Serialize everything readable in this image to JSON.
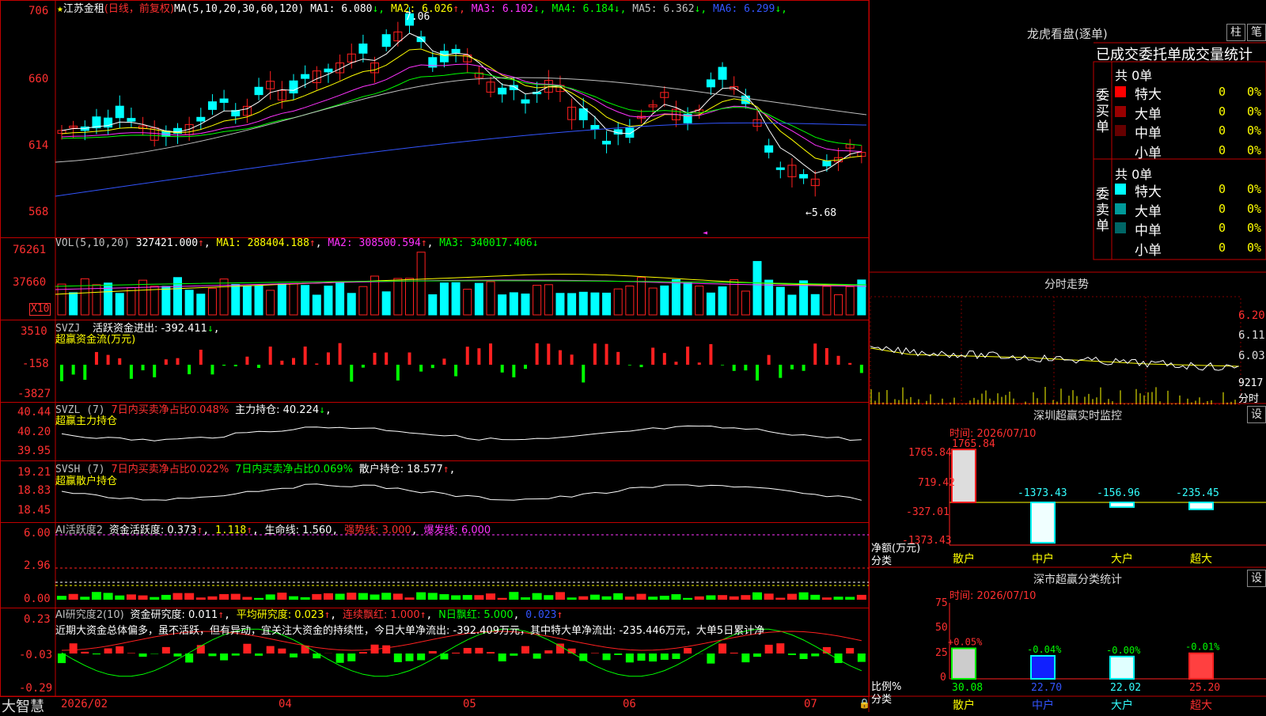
{
  "stock": {
    "name": "江苏金租",
    "mode": "(日线，前复权)",
    "ma_def": "MA(5,10,20,30,60,120)",
    "star": "★"
  },
  "ma_legend": [
    {
      "label": "MA1: 6.080",
      "arrow": "↓",
      "color": "#ffffff"
    },
    {
      "label": "MA2: 6.026",
      "arrow": "↑",
      "color": "#ffff00"
    },
    {
      "label": "MA3: 6.102",
      "arrow": "↓",
      "color": "#ff33ff"
    },
    {
      "label": "MA4: 6.184",
      "arrow": "↓",
      "color": "#00ff00"
    },
    {
      "label": "MA5: 6.362",
      "arrow": "↓",
      "color": "#c0c0c0"
    },
    {
      "label": "MA6: 6.299",
      "arrow": "↓",
      "color": "#3355ff"
    }
  ],
  "price_axis": [
    "706",
    "660",
    "614",
    "568"
  ],
  "price_high_label": "7.06",
  "price_low_label": "←5.68",
  "vol": {
    "header": "VOL(5,10,20)",
    "value": "327421.000",
    "ma1": "MA1: 288404.188",
    "ma2": "MA2: 308500.594",
    "ma3": "MA3: 340017.406",
    "axis": [
      "76261",
      "37660"
    ],
    "unit": "X10"
  },
  "svzj": {
    "header": "SVZJ",
    "title": "活跃资金进出: -392.411",
    "subtitle": "超赢资金流(万元)",
    "axis": [
      "3510",
      "-158",
      "-3827"
    ]
  },
  "svzl": {
    "header": "SVZL (7)",
    "t1": "7日内买卖净占比0.048%",
    "t2": "主力持仓: 40.224",
    "subtitle": "超赢主力持仓",
    "axis": [
      "40.44",
      "40.20",
      "39.95"
    ]
  },
  "svsh": {
    "header": "SVSH (7)",
    "t1": "7日内买卖净占比0.022%",
    "t2": "7日内买卖净占比0.069%",
    "t3": "散户持仓: 18.577",
    "subtitle": "超赢散户持仓",
    "axis": [
      "19.21",
      "18.83",
      "18.45"
    ]
  },
  "ai1": {
    "header": "AI活跃度2",
    "t1": "资金活跃度: 0.373",
    "t2": "1.118",
    "t3": "生命线: 1.560",
    "t4": "强势线: 3.000",
    "t5": "爆发线: 6.000",
    "axis": [
      "6.00",
      "2.96",
      "0.00"
    ]
  },
  "ai2": {
    "header": "AI研究度2(10)",
    "t1": "资金研究度: 0.011",
    "t2": "平均研究度: 0.023",
    "t3": "连续飘红: 1.000",
    "t4": "N日飘红: 5.000",
    "t5": "0.023",
    "comment": "近期大资金总体偏多，虽不活跃，但有异动，宜关注大资金的持续性，今日大单净流出: -392.409万元，其中特大单净流出: -235.446万元，大单5日累计净",
    "axis": [
      "0.23",
      "-0.03",
      "-0.29"
    ]
  },
  "xaxis": [
    "2026/02",
    "04",
    "05",
    "06",
    "07"
  ],
  "footer_logo": "大智慧",
  "right": {
    "lhb_title": "龙虎看盘(逐单)",
    "btn1": "柱",
    "btn2": "笔",
    "tabs": "已成交委托单成交量统计",
    "buy_label": "委买单",
    "sell_label": "委卖单",
    "buy_total": "共 0单",
    "sell_total": "共 0单",
    "buy_rows": [
      {
        "name": "特大",
        "count": "0",
        "pct": "0%",
        "color": "#ff0000"
      },
      {
        "name": "大单",
        "count": "0",
        "pct": "0%",
        "color": "#990000"
      },
      {
        "name": "中单",
        "count": "0",
        "pct": "0%",
        "color": "#660000"
      },
      {
        "name": "小单",
        "count": "0",
        "pct": "0%",
        "color": "#000000"
      }
    ],
    "sell_rows": [
      {
        "name": "特大",
        "count": "0",
        "pct": "0%",
        "color": "#00ffff"
      },
      {
        "name": "大单",
        "count": "0",
        "pct": "0%",
        "color": "#009999"
      },
      {
        "name": "中单",
        "count": "0",
        "pct": "0%",
        "color": "#006666"
      },
      {
        "name": "小单",
        "count": "0",
        "pct": "0%",
        "color": "#000000"
      }
    ],
    "intraday_title": "分时走势",
    "intraday_axis": [
      "6.20",
      "6.11",
      "6.03"
    ],
    "intraday_vol": "9217",
    "intraday_label": "分时",
    "monitor_title": "深圳超赢实时监控",
    "set": "设",
    "monitor_time": "时间: 2026/07/10",
    "monitor_axis": [
      "1765.84",
      "719.42",
      "-327.01",
      "-1373.43"
    ],
    "monitor_ylabel": "净额(万元)",
    "monitor_xlabel": "分类",
    "classify_title": "深市超赢分类统计",
    "classify_time": "时间: 2026/07/10",
    "classify_axis": [
      "75",
      "50",
      "25",
      "0"
    ],
    "classify_ylabel": "比例%",
    "classify_xlabel": "分类"
  },
  "chart_data": [
    {
      "type": "bar",
      "title": "深圳超赢实时监控",
      "ylabel": "净额(万元)",
      "xlabel": "分类",
      "categories": [
        "散户",
        "中户",
        "大户",
        "超大"
      ],
      "values": [
        1765.84,
        -1373.43,
        -156.96,
        -235.45
      ],
      "ylim": [
        -1373.43,
        1765.84
      ]
    },
    {
      "type": "bar",
      "title": "深市超赢分类统计",
      "ylabel": "比例%",
      "xlabel": "分类",
      "categories": [
        "散户",
        "中户",
        "大户",
        "超大"
      ],
      "values": [
        30.08,
        22.7,
        22.02,
        25.2
      ],
      "changes": [
        "+0.05%",
        "-0.04%",
        "-0.00%",
        "-0.01%"
      ],
      "ylim": [
        0,
        75
      ]
    }
  ]
}
